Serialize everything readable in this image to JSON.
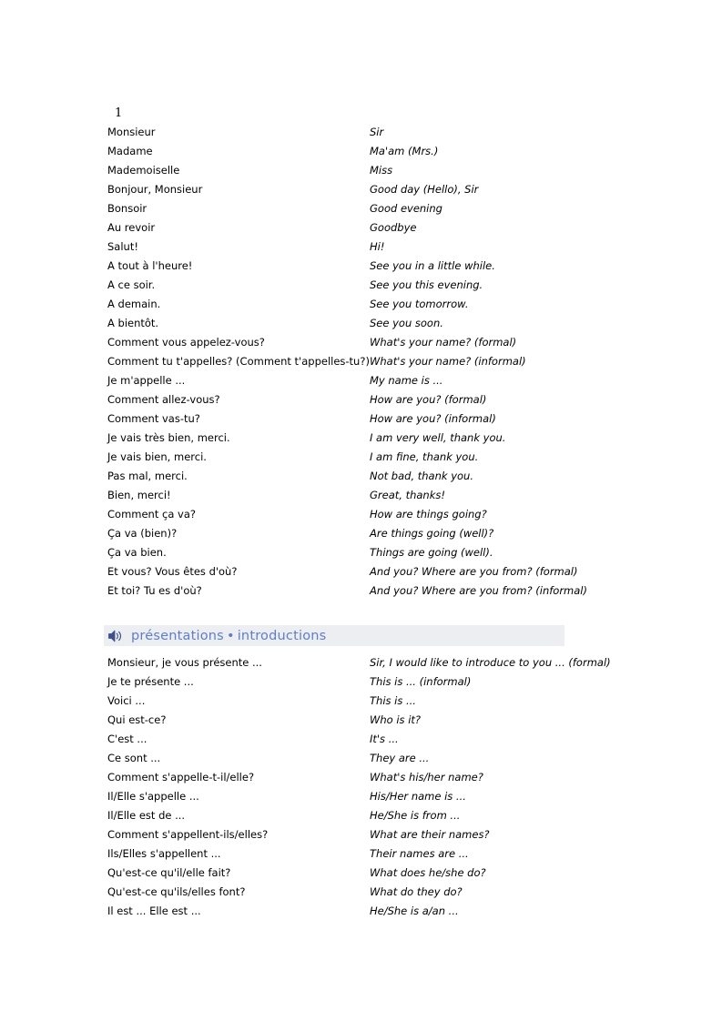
{
  "page": {
    "marker": "1",
    "background_color": "#ffffff"
  },
  "sections": [
    {
      "id": "greetings",
      "has_header_band": false,
      "rows": [
        {
          "fr": "Monsieur",
          "en": "Sir"
        },
        {
          "fr": "Madame",
          "en": "Ma'am (Mrs.)"
        },
        {
          "fr": "Mademoiselle",
          "en": "Miss"
        },
        {
          "fr": "Bonjour, Monsieur",
          "en": "Good day (Hello), Sir"
        },
        {
          "fr": "Bonsoir",
          "en": "Good evening"
        },
        {
          "fr": "Au revoir",
          "en": "Goodbye"
        },
        {
          "fr": "Salut!",
          "en": "Hi!"
        },
        {
          "fr": "A tout à l'heure!",
          "en": "See you in a little while."
        },
        {
          "fr": "A ce soir.",
          "en": "See you this evening."
        },
        {
          "fr": "A demain.",
          "en": "See you tomorrow."
        },
        {
          "fr": "A bientôt.",
          "en": "See you soon."
        },
        {
          "fr": "Comment vous appelez-vous?",
          "en": "What's your name? (formal)"
        },
        {
          "fr": "Comment tu t'appelles? (Comment t'appelles-tu?)",
          "en": "What's your name? (informal)"
        },
        {
          "fr": "Je m'appelle ...",
          "en": "My name is ..."
        },
        {
          "fr": "Comment allez-vous?",
          "en": "How are you? (formal)"
        },
        {
          "fr": "Comment vas-tu?",
          "en": "How are you? (informal)"
        },
        {
          "fr": "Je vais très bien, merci.",
          "en": "I am very well, thank you."
        },
        {
          "fr": "Je vais bien, merci.",
          "en": "I am fine, thank you."
        },
        {
          "fr": "Pas mal, merci.",
          "en": "Not bad, thank you."
        },
        {
          "fr": "Bien, merci!",
          "en": "Great, thanks!"
        },
        {
          "fr": "Comment ça va?",
          "en": "How are things going?"
        },
        {
          "fr": "Ça va (bien)?",
          "en": "Are things going (well)?"
        },
        {
          "fr": "Ça va bien.",
          "en": "Things are going (well)."
        },
        {
          "fr": "Et vous? Vous êtes d'où?",
          "en": "And you? Where are you from? (formal)"
        },
        {
          "fr": "Et toi? Tu es d'où?",
          "en": "And you? Where are you from? (informal)"
        }
      ]
    },
    {
      "id": "introductions",
      "has_header_band": true,
      "header": {
        "icon": "speaker-audio-icon",
        "title_fr": "présentations",
        "separator": "•",
        "title_en": "introductions",
        "band_color": "#edeef2",
        "text_color": "#5f7ec9"
      },
      "rows": [
        {
          "fr": "Monsieur, je vous présente ...",
          "en": "Sir, I would like to introduce to you ... (formal)"
        },
        {
          "fr": "Je te présente ...",
          "en": "This is ... (informal)"
        },
        {
          "fr": "Voici ...",
          "en": "This is ..."
        },
        {
          "fr": "Qui est-ce?",
          "en": "Who is it?"
        },
        {
          "fr": "C'est ...",
          "en": "It's ..."
        },
        {
          "fr": "Ce sont ...",
          "en": "They are ..."
        },
        {
          "fr": "Comment s'appelle-t-il/elle?",
          "en": "What's his/her name?"
        },
        {
          "fr": "Il/Elle s'appelle ...",
          "en": "His/Her name is ..."
        },
        {
          "fr": "Il/Elle est de ...",
          "en": "He/She is from ..."
        },
        {
          "fr": "Comment s'appellent-ils/elles?",
          "en": "What are their names?"
        },
        {
          "fr": "Ils/Elles s'appellent ...",
          "en": "Their names are ..."
        },
        {
          "fr": "Qu'est-ce qu'il/elle fait?",
          "en": "What does he/she do?"
        },
        {
          "fr": "Qu'est-ce qu'ils/elles font?",
          "en": "What do they do?"
        },
        {
          "fr": "Il est ... Elle est ...",
          "en": "He/She is a/an ..."
        }
      ]
    }
  ]
}
